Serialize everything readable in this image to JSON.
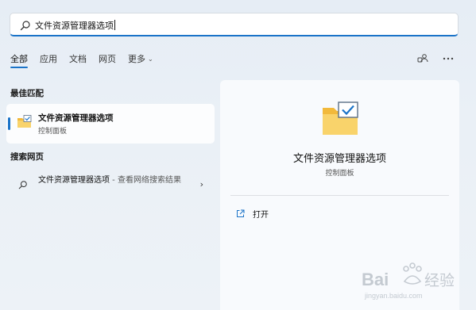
{
  "search": {
    "value": "文件资源管理器选项",
    "icon": "search-icon"
  },
  "tabs": [
    {
      "label": "全部",
      "active": true
    },
    {
      "label": "应用",
      "active": false
    },
    {
      "label": "文档",
      "active": false
    },
    {
      "label": "网页",
      "active": false
    },
    {
      "label": "更多",
      "active": false
    }
  ],
  "toolbar": {
    "share_icon": "share-accounts-icon",
    "more_icon": "more-options-icon"
  },
  "best_match": {
    "section_title": "最佳匹配",
    "name": "文件资源管理器选项",
    "subtitle": "控制面板",
    "icon": "folder-check-icon"
  },
  "web_search": {
    "section_title": "搜索网页",
    "query": "文件资源管理器选项",
    "suffix": " - 查看网络搜索结果",
    "icon": "search-icon"
  },
  "preview": {
    "title": "文件资源管理器选项",
    "subtitle": "控制面板",
    "action_label": "打开",
    "action_icon": "open-external-icon"
  },
  "watermark": {
    "text": "Baidu 经验",
    "url": "jingyan.baidu.com"
  },
  "colors": {
    "accent": "#1a73c8",
    "folder_yellow": "#f7c948",
    "check_blue": "#1a73c8"
  }
}
